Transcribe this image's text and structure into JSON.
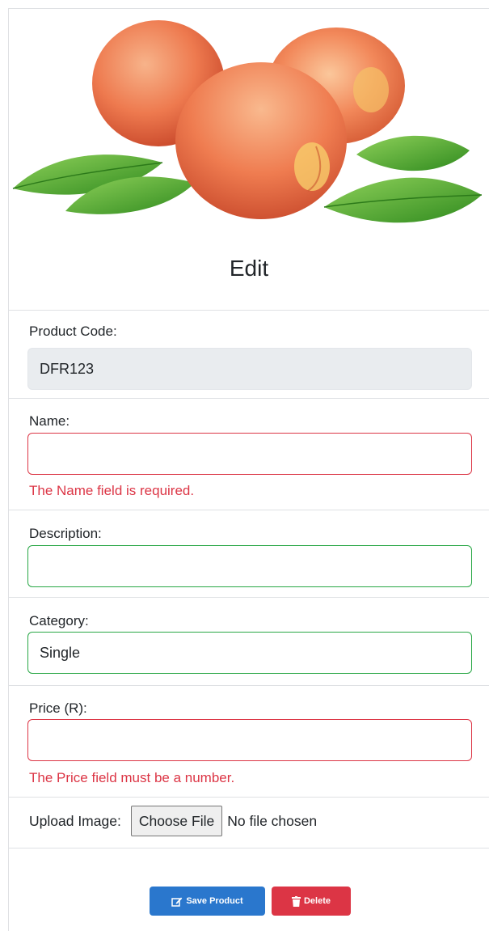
{
  "page": {
    "title": "Edit",
    "image_alt": "peaches"
  },
  "form": {
    "product_code": {
      "label": "Product Code:",
      "value": "DFR123"
    },
    "name": {
      "label": "Name:",
      "value": "",
      "error": "The Name field is required."
    },
    "description": {
      "label": "Description:",
      "value": ""
    },
    "category": {
      "label": "Category:",
      "value": "Single"
    },
    "price": {
      "label": "Price (R):",
      "value": "",
      "error": "The Price field must be a number."
    },
    "upload": {
      "label": "Upload Image:",
      "button": "Choose File",
      "status": "No file chosen"
    }
  },
  "actions": {
    "save_label": "Save Product",
    "delete_label": "Delete"
  },
  "colors": {
    "invalid": "#dc3545",
    "valid": "#28a745",
    "primary": "#2a77cd",
    "danger": "#dc3545"
  }
}
